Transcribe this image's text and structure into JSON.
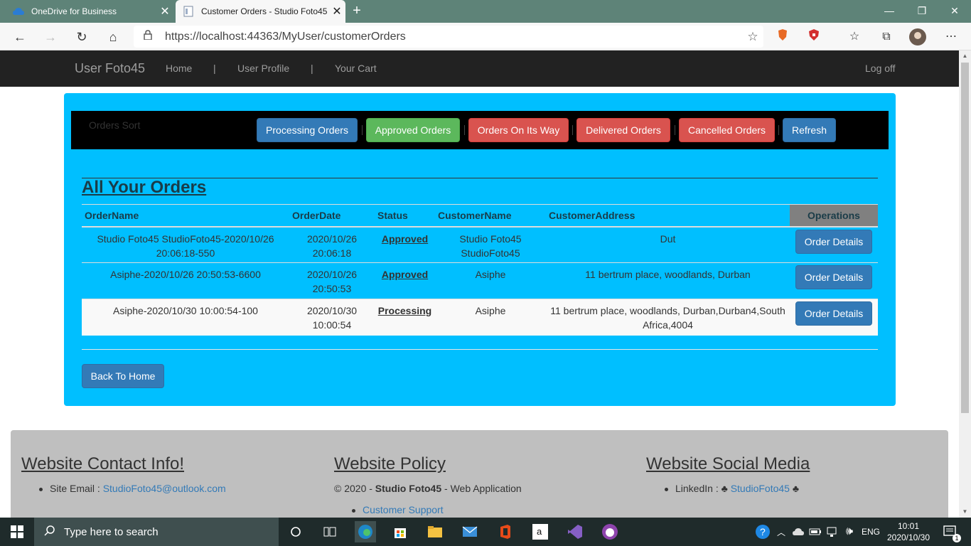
{
  "browser": {
    "tabs": [
      {
        "label": "OneDrive for Business",
        "close": "✕"
      },
      {
        "label": "Customer Orders - Studio Foto45",
        "close": "✕"
      }
    ],
    "new_tab": "+",
    "url": "https://localhost:44363/MyUser/customerOrders",
    "window_controls": {
      "minimize": "—",
      "restore": "❐",
      "close": "✕"
    }
  },
  "navbar": {
    "brand": "User Foto45",
    "links": [
      {
        "label": "Home"
      },
      {
        "label": "|"
      },
      {
        "label": "User Profile"
      },
      {
        "label": "|"
      },
      {
        "label": "Your Cart"
      }
    ],
    "logoff": "Log off"
  },
  "sort_bar": {
    "label": "Orders Sort",
    "buttons": {
      "processing": "Processing Orders",
      "approved": "Approved Orders",
      "on_its_way": "Orders On Its Way",
      "delivered": "Delivered Orders",
      "cancelled": "Cancelled Orders",
      "refresh": "Refresh"
    }
  },
  "orders": {
    "title": "All Your Orders",
    "columns": [
      "OrderName",
      "OrderDate",
      "Status",
      "CustomerName",
      "CustomerAddress",
      "Operations"
    ],
    "rows": [
      {
        "name": "Studio Foto45 StudioFoto45-2020/10/26 20:06:18-550",
        "date": "2020/10/26 20:06:18",
        "status": "Approved",
        "customer": "Studio Foto45 StudioFoto45",
        "address": "Dut",
        "action": "Order Details"
      },
      {
        "name": "Asiphe-2020/10/26 20:50:53-6600",
        "date": "2020/10/26 20:50:53",
        "status": "Approved",
        "customer": "Asiphe",
        "address": "11 bertrum place, woodlands, Durban",
        "action": "Order Details"
      },
      {
        "name": "Asiphe-2020/10/30 10:00:54-100",
        "date": "2020/10/30 10:00:54",
        "status": "Processing",
        "customer": "Asiphe",
        "address": "11 bertrum place, woodlands, Durban,Durban4,South Africa,4004",
        "action": "Order Details"
      }
    ],
    "back_button": "Back To Home"
  },
  "footer": {
    "contact": {
      "heading": "Website Contact Info!",
      "email_label": "Site Email : ",
      "email": "StudioFoto45@outlook.com"
    },
    "policy": {
      "heading": "Website Policy",
      "copyright_prefix": "© 2020 - ",
      "company": "Studio Foto45",
      "copyright_suffix": " - Web Application",
      "support_link": "Customer Support"
    },
    "social": {
      "heading": "Website Social Media",
      "linkedin_label": "LinkedIn : ♣ ",
      "linkedin": "StudioFoto45",
      "linkedin_suffix": " ♣"
    }
  },
  "taskbar": {
    "search_placeholder": "Type here to search",
    "language": "ENG",
    "time": "10:01",
    "date": "2020/10/30",
    "notifications": "1"
  },
  "colors": {
    "panel": "#00bfff",
    "primary": "#337ab7",
    "success": "#5cb85c",
    "danger": "#d9534f",
    "navbar": "#222222"
  }
}
